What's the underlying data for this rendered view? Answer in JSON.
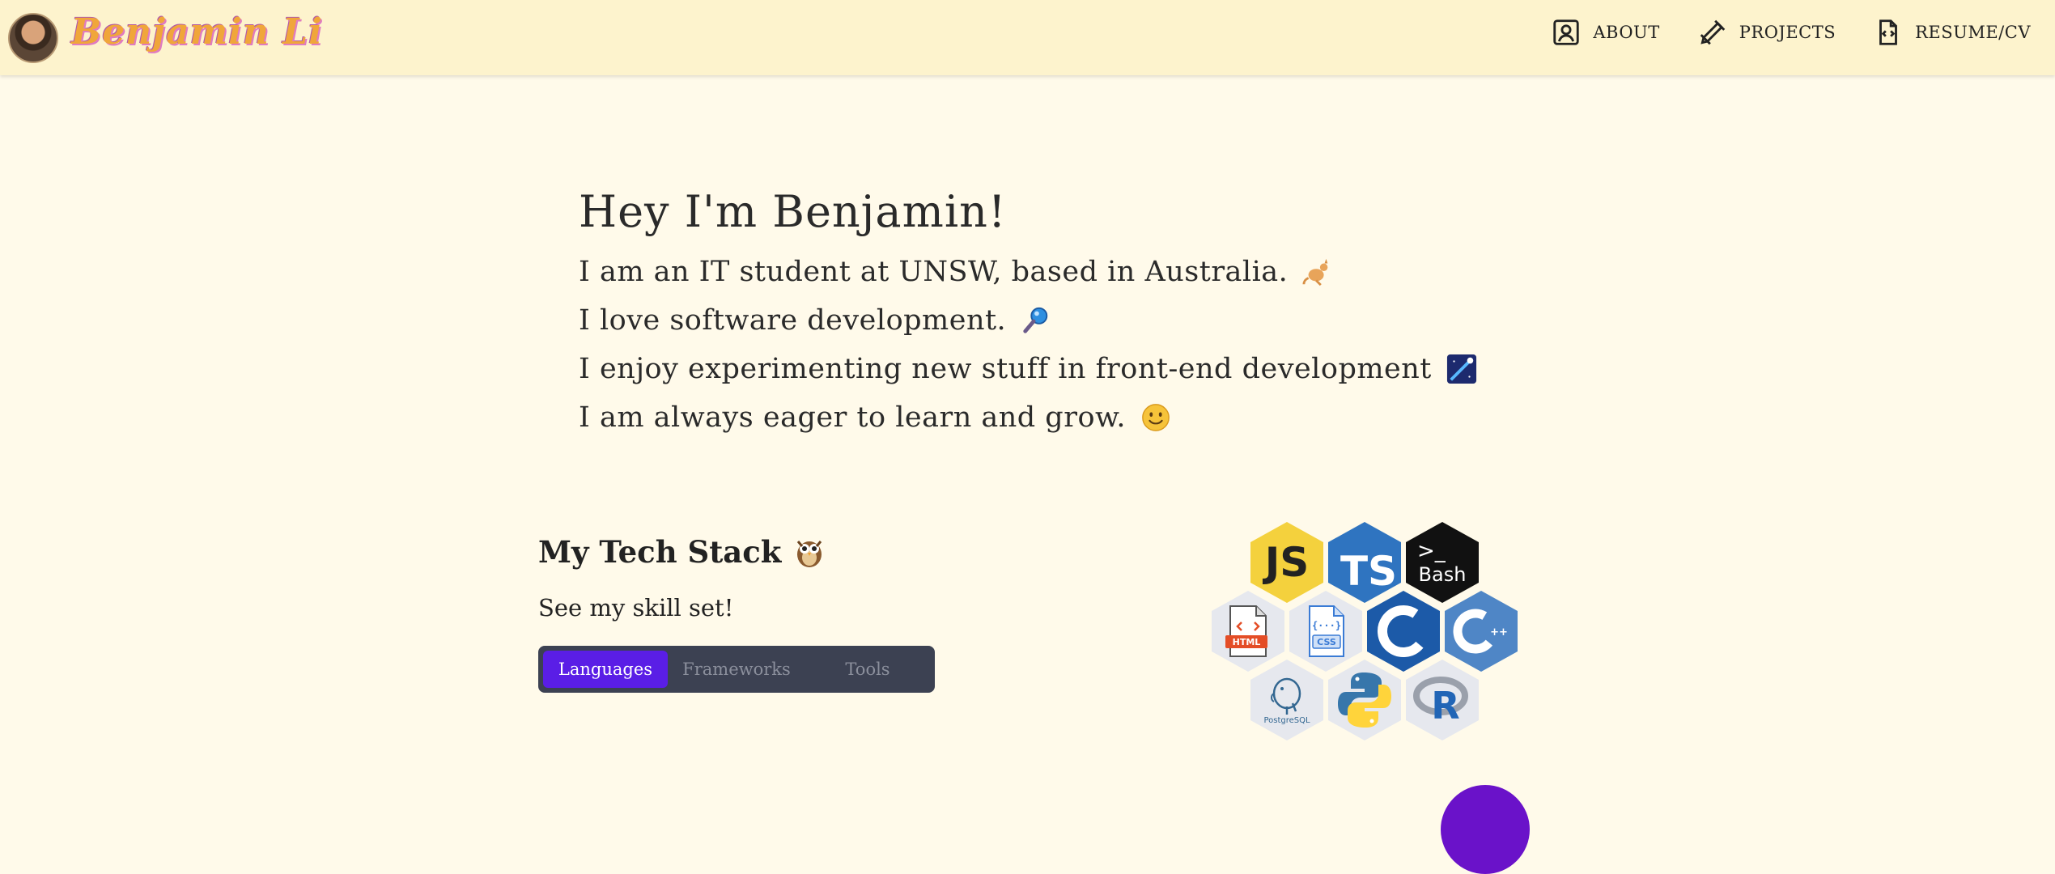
{
  "header": {
    "brand": "Benjamin Li",
    "nav": [
      {
        "label": "ABOUT",
        "icon": "user-square-icon"
      },
      {
        "label": "PROJECTS",
        "icon": "pencil-ruler-icon"
      },
      {
        "label": "RESUME/CV",
        "icon": "file-code-icon"
      }
    ]
  },
  "intro": {
    "heading": "Hey I'm Benjamin!",
    "lines": [
      {
        "text": "I am an IT student at UNSW, based in Australia.",
        "emoji": "kangaroo-icon"
      },
      {
        "text": "I love software development.",
        "emoji": "magnifier-icon"
      },
      {
        "text": "I enjoy experimenting new stuff in front-end development",
        "emoji": "shooting-star-icon"
      },
      {
        "text": "I am always eager to learn and grow.",
        "emoji": "smile-icon"
      }
    ]
  },
  "stack": {
    "title": "My Tech Stack",
    "subtitle": "See my skill set!",
    "tabs": [
      "Languages",
      "Frameworks",
      "Tools"
    ],
    "active_tab": "Languages",
    "icons": [
      {
        "name": "javascript-icon",
        "label": "JS"
      },
      {
        "name": "typescript-icon",
        "label": "TS"
      },
      {
        "name": "bash-icon",
        "label": "Bash",
        "prompt": ">_"
      },
      {
        "name": "html-icon",
        "label": "HTML"
      },
      {
        "name": "css-icon",
        "label": "CSS"
      },
      {
        "name": "c-icon",
        "label": "C"
      },
      {
        "name": "cpp-icon",
        "label": "C++"
      },
      {
        "name": "postgresql-icon",
        "label": "PostgreSQL"
      },
      {
        "name": "python-icon",
        "label": ""
      },
      {
        "name": "r-icon",
        "label": "R"
      }
    ]
  },
  "colors": {
    "page_bg": "#fffaea",
    "header_bg": "#fdf3cd",
    "tab_active": "#5a1ee6",
    "tab_bar": "#3c4152"
  }
}
